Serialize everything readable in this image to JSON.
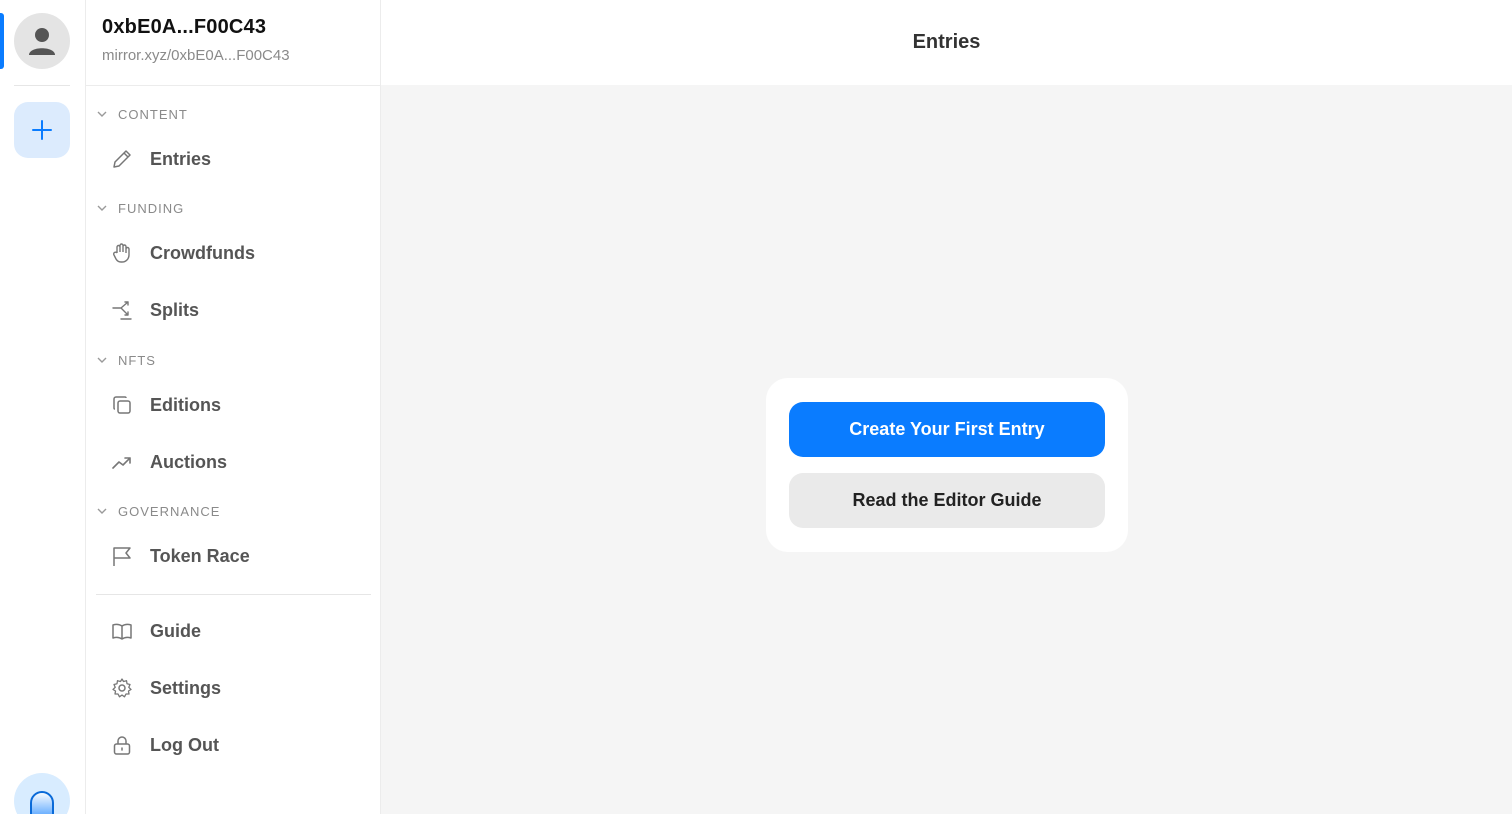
{
  "rail": {
    "avatar_icon": "user-avatar-icon",
    "add_icon": "plus-icon",
    "bottom_icon": "mirror-logo-icon",
    "accent_color": "#0a7cff"
  },
  "sidebar": {
    "account_name": "0xbE0A...F00C43",
    "account_url": "mirror.xyz/0xbE0A...F00C43",
    "sections": {
      "content": "CONTENT",
      "funding": "FUNDING",
      "nfts": "NFTS",
      "governance": "GOVERNANCE"
    },
    "items": {
      "entries": "Entries",
      "crowdfunds": "Crowdfunds",
      "splits": "Splits",
      "editions": "Editions",
      "auctions": "Auctions",
      "token_race": "Token Race",
      "guide": "Guide",
      "settings": "Settings",
      "log_out": "Log Out"
    }
  },
  "header": {
    "title": "Entries"
  },
  "empty_state": {
    "primary_label": "Create Your First Entry",
    "secondary_label": "Read the Editor Guide"
  }
}
